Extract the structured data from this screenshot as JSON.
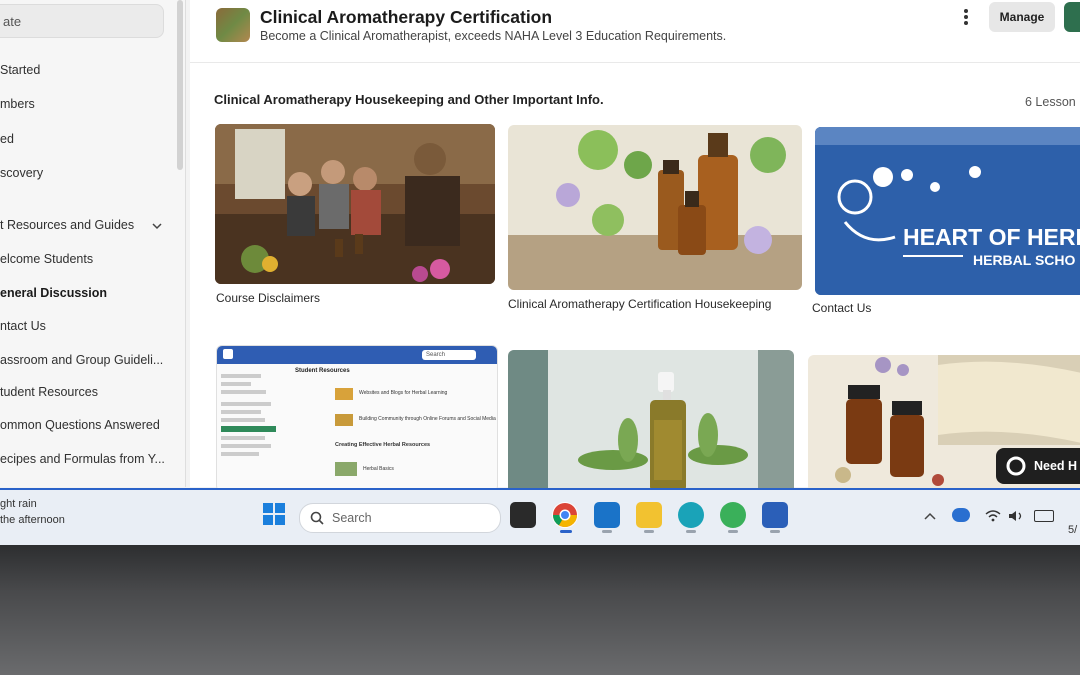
{
  "sidebar": {
    "search_fragment": "ate",
    "items": [
      {
        "label": "Started",
        "bold": false
      },
      {
        "label": "mbers",
        "bold": false
      },
      {
        "label": "ed",
        "bold": false
      },
      {
        "label": "scovery",
        "bold": false
      },
      {
        "label": "t Resources and Guides",
        "bold": false
      },
      {
        "label": "elcome Students",
        "bold": false
      },
      {
        "label": "eneral Discussion",
        "bold": true
      },
      {
        "label": "ntact Us",
        "bold": false
      },
      {
        "label": "assroom and Group Guideli...",
        "bold": false
      },
      {
        "label": "tudent Resources",
        "bold": false
      },
      {
        "label": "ommon Questions Answered",
        "bold": false
      },
      {
        "label": "ecipes and Formulas from Y...",
        "bold": false
      }
    ]
  },
  "header": {
    "title": "Clinical Aromatherapy Certification",
    "subtitle": "Become a Clinical Aromatherapist, exceeds NAHA Level 3 Education Requirements.",
    "manage_label": "Manage"
  },
  "section": {
    "title": "Clinical Aromatherapy Housekeeping and Other Important Info.",
    "lesson_count": "6 Lesson"
  },
  "cards": [
    {
      "label": "Course Disclaimers"
    },
    {
      "label": "Clinical Aromatherapy Certification Housekeeping"
    },
    {
      "label": "Contact Us",
      "logo_line1": "HEART OF HERE",
      "logo_line2": "HERBAL SCHO"
    },
    {
      "label": ""
    },
    {
      "label": ""
    },
    {
      "label": ""
    }
  ],
  "mini_screenshot": {
    "search": "Search",
    "section_title": "Student Resources",
    "rows": [
      "Websites and Blogs for Herbal Learning",
      "Building Community through Online Forums and Social Media"
    ],
    "subheading": "Creating Effective Herbal Resources",
    "row3": "Herbal Basics"
  },
  "help_button": {
    "label": "Need H"
  },
  "taskbar": {
    "weather_line1": "ght rain",
    "weather_line2": "the afternoon",
    "search_placeholder": "Search",
    "clock_fragment": "5/"
  }
}
